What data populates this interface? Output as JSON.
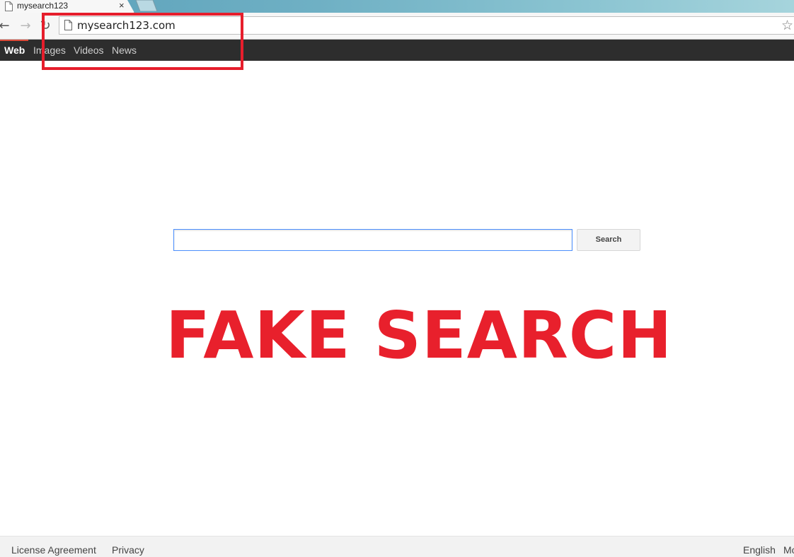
{
  "browser": {
    "tab": {
      "title": "mysearch123",
      "close_glyph": "×"
    },
    "toolbar": {
      "back_glyph": "←",
      "forward_glyph": "→",
      "reload_glyph": "↻",
      "url": "mysearch123.com",
      "star_glyph": "☆"
    }
  },
  "navbar": {
    "items": [
      {
        "label": "Web",
        "active": true
      },
      {
        "label": "Images",
        "active": false
      },
      {
        "label": "Videos",
        "active": false
      },
      {
        "label": "News",
        "active": false
      }
    ]
  },
  "search": {
    "input_value": "",
    "button_label": "Search"
  },
  "overlay": {
    "text": "FAKE SEARCH"
  },
  "footer": {
    "license_label": "License Agreement",
    "privacy_label": "Privacy",
    "language_label": "English",
    "more_label": "Mo"
  },
  "colors": {
    "highlight": "#e61e2c",
    "overlay_text": "#e8202c",
    "navbar_bg": "#2d2d2d",
    "input_focus": "#4d90fe"
  },
  "icons": [
    "page-icon",
    "close-icon",
    "back-icon",
    "forward-icon",
    "reload-icon",
    "star-icon"
  ]
}
